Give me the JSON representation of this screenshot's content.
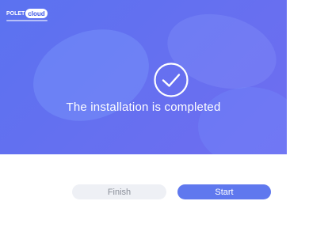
{
  "brand": {
    "word": "POLET",
    "cloud": "cloud"
  },
  "status": {
    "headline": "The installation is completed",
    "icon": "check-circle-icon"
  },
  "actions": {
    "finish_label": "Finish",
    "start_label": "Start"
  },
  "colors": {
    "hero": "#6470f0",
    "primary_button": "#5f78ee",
    "secondary_button": "#eef0f5"
  }
}
